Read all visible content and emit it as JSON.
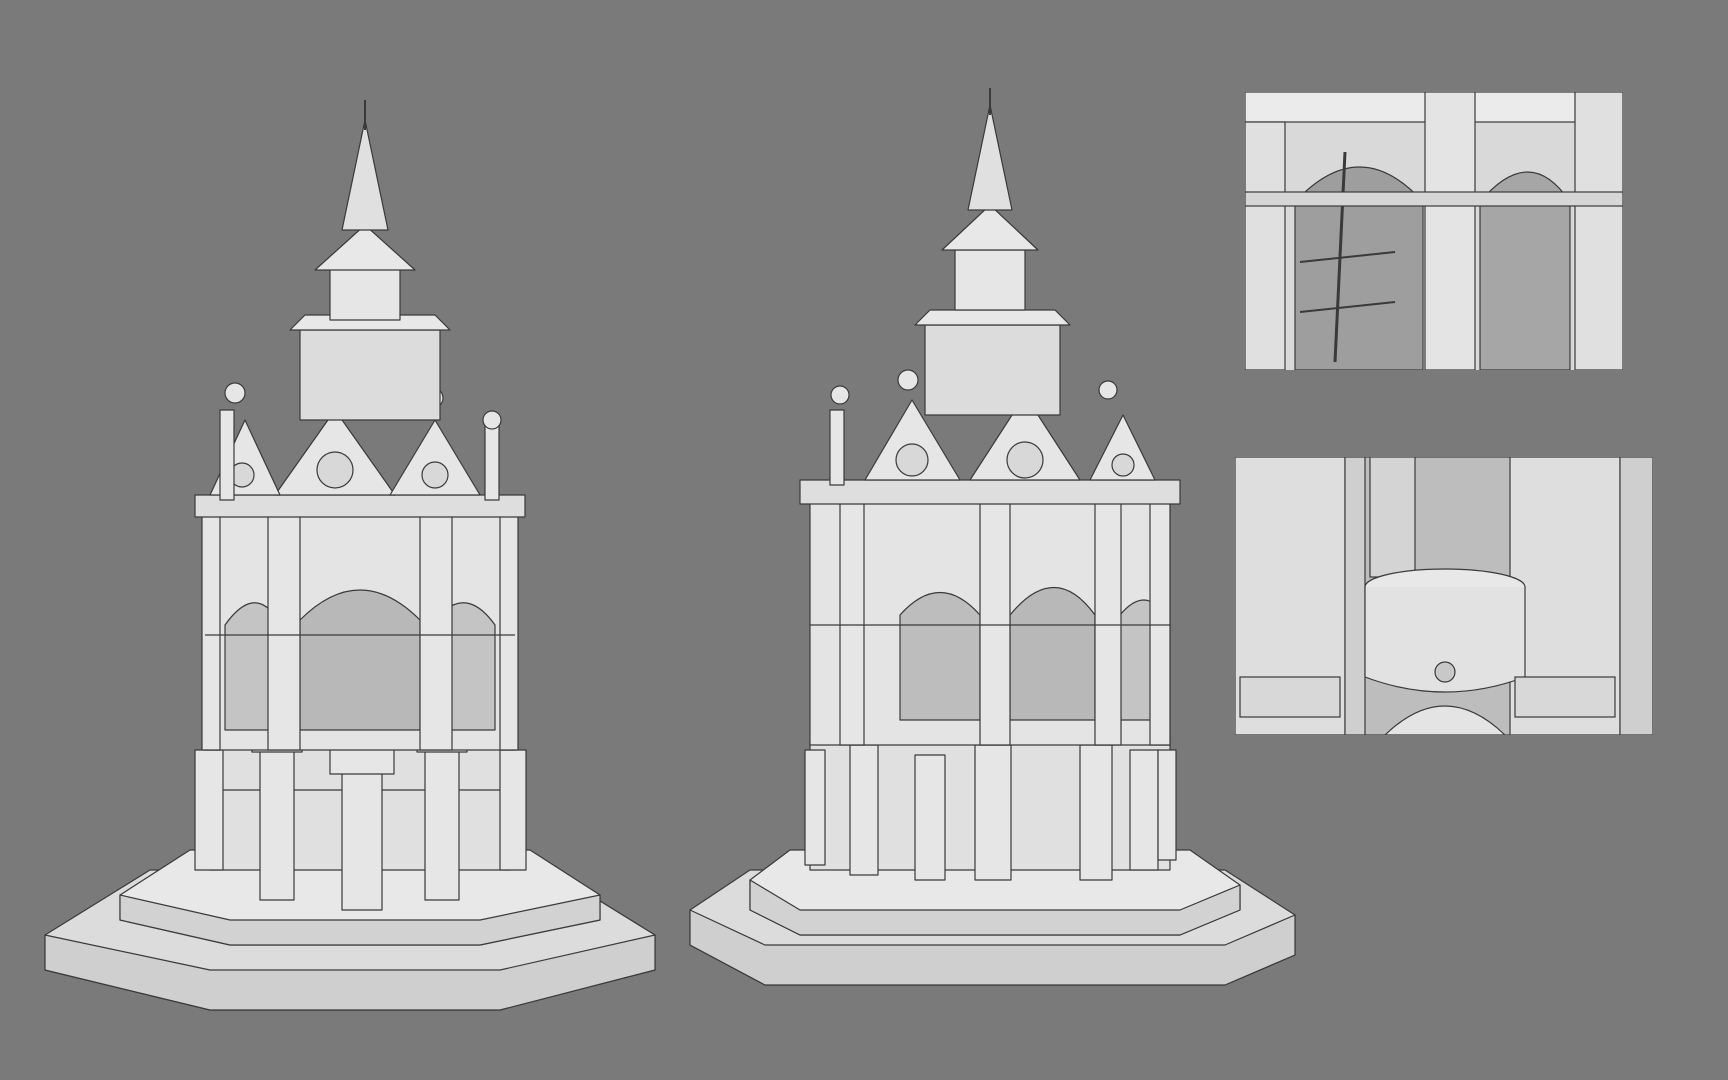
{
  "scene": {
    "background_color": "#7a7a7a",
    "model_fill": "#e6e6e6",
    "model_shade": "#cfcfcf",
    "model_dark": "#a8a8a8",
    "wire_color": "#3a3a3a"
  },
  "views": [
    {
      "id": "front-three-quarter",
      "icon": "pavilion-render"
    },
    {
      "id": "side-three-quarter",
      "icon": "pavilion-render"
    }
  ],
  "details": [
    {
      "id": "upper-arches-closeup",
      "icon": "arch-detail"
    },
    {
      "id": "fountain-basin-closeup",
      "icon": "basin-detail"
    }
  ]
}
